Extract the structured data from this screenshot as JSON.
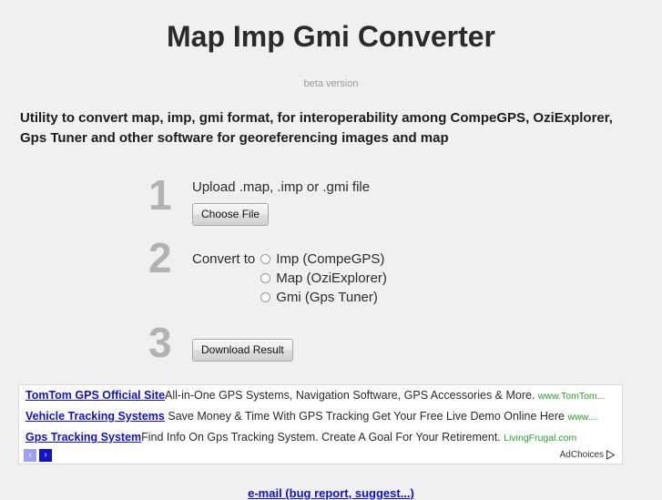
{
  "header": {
    "title": "Map Imp Gmi Converter",
    "subtitle": "beta version"
  },
  "intro": {
    "text": "Utility to convert map, imp, gmi format, for interoperability among CompeGPS, OziExplorer, Gps Tuner and other software for georeferencing images and map"
  },
  "steps": [
    {
      "number": "1",
      "label": "Upload .map, .imp or .gmi file",
      "button_label": "Choose File"
    },
    {
      "number": "2",
      "label": "Convert to",
      "options": [
        {
          "label": "Imp (CompeGPS)",
          "selected": false
        },
        {
          "label": "Map (OziExplorer)",
          "selected": false
        },
        {
          "label": "Gmi (Gps Tuner)",
          "selected": false
        }
      ]
    },
    {
      "number": "3",
      "button_label": "Download Result"
    }
  ],
  "ads": {
    "items": [
      {
        "link": "TomTom GPS Official Site",
        "description": "All-in-One GPS Systems, Navigation Software, GPS Accessories & More.",
        "url": "www.TomTom..."
      },
      {
        "link": "Vehicle Tracking Systems",
        "description": "Save Money & Time With GPS Tracking Get Your Free Live Demo Online Here",
        "url": "www...."
      },
      {
        "link": "Gps Tracking System",
        "description": "Find Info On Gps Tracking System. Create A Goal For Your Retirement.",
        "url": "LivingFrugal.com"
      }
    ],
    "nav": {
      "prev": "‹",
      "next": "›"
    },
    "adchoices_label": "AdChoices"
  },
  "footer": {
    "email_link": "e-mail (bug report, suggest...)"
  },
  "colors": {
    "page_background": "#f0f0f0",
    "step_number": "#b2b2b2",
    "ad_link": "#1111cc",
    "ad_url": "#2a9d2a",
    "subtitle": "#9a9a9a"
  }
}
